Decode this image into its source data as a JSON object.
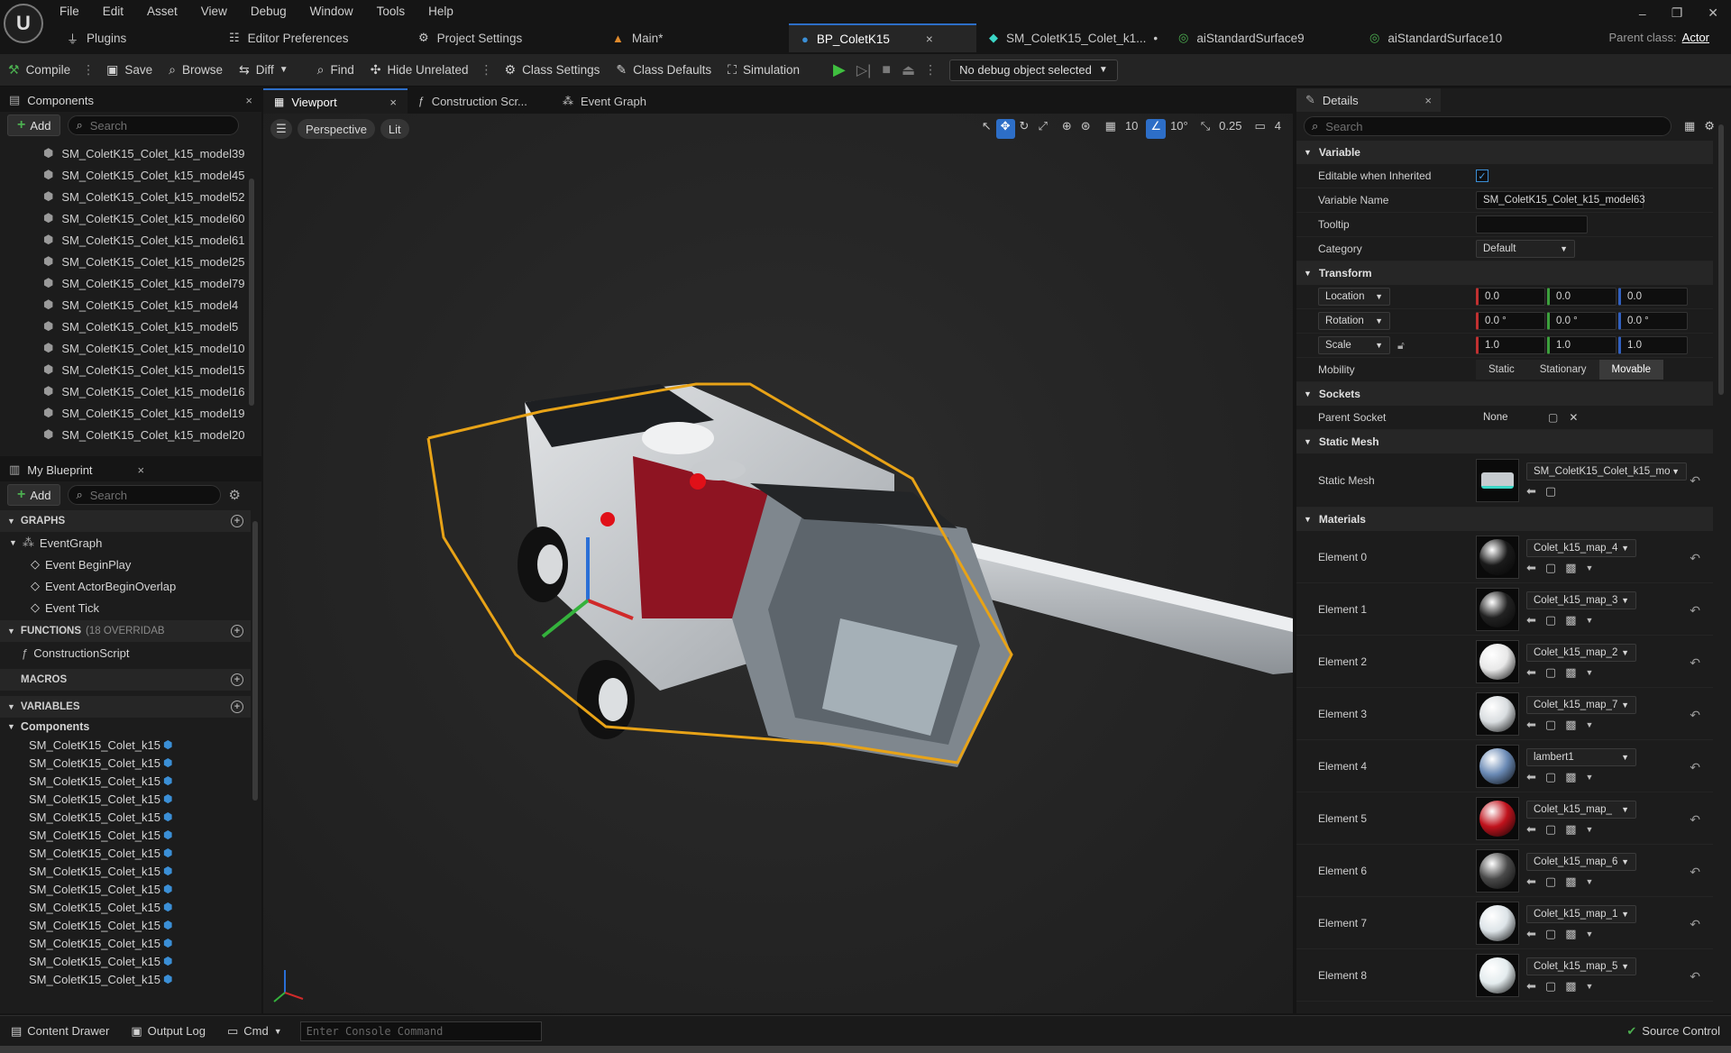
{
  "menus": [
    "File",
    "Edit",
    "Asset",
    "View",
    "Debug",
    "Window",
    "Tools",
    "Help"
  ],
  "tabs": [
    {
      "label": "Plugins",
      "icon": "plug-icon"
    },
    {
      "label": "Editor Preferences",
      "icon": "sliders-icon"
    },
    {
      "label": "Project Settings",
      "icon": "gear-icon"
    },
    {
      "label": "Main*",
      "icon": "level-icon"
    },
    {
      "label": "BP_ColetK15",
      "icon": "blueprint-icon",
      "close": "×"
    },
    {
      "label": "SM_ColetK15_Colet_k1...",
      "icon": "static-mesh-icon",
      "mark": "•"
    },
    {
      "label": "aiStandardSurface9",
      "icon": "material-icon"
    },
    {
      "label": "aiStandardSurface10",
      "icon": "material-icon"
    }
  ],
  "parent_class": {
    "label": "Parent class:",
    "value": "Actor"
  },
  "toolbar": {
    "compile": "Compile",
    "save": "Save",
    "browse": "Browse",
    "diff": "Diff",
    "find": "Find",
    "hide_unrelated": "Hide Unrelated",
    "class_settings": "Class Settings",
    "class_defaults": "Class Defaults",
    "simulation": "Simulation",
    "debug_select": "No debug object selected"
  },
  "components": {
    "title": "Components",
    "add": "Add",
    "search_placeholder": "Search",
    "items": [
      "SM_ColetK15_Colet_k15_model39",
      "SM_ColetK15_Colet_k15_model45",
      "SM_ColetK15_Colet_k15_model52",
      "SM_ColetK15_Colet_k15_model60",
      "SM_ColetK15_Colet_k15_model61",
      "SM_ColetK15_Colet_k15_model25",
      "SM_ColetK15_Colet_k15_model79",
      "SM_ColetK15_Colet_k15_model4",
      "SM_ColetK15_Colet_k15_model5",
      "SM_ColetK15_Colet_k15_model10",
      "SM_ColetK15_Colet_k15_model15",
      "SM_ColetK15_Colet_k15_model16",
      "SM_ColetK15_Colet_k15_model19",
      "SM_ColetK15_Colet_k15_model20"
    ]
  },
  "my_blueprint": {
    "title": "My Blueprint",
    "add": "Add",
    "search_placeholder": "Search",
    "graphs_label": "GRAPHS",
    "event_graph": "EventGraph",
    "events": [
      "Event BeginPlay",
      "Event ActorBeginOverlap",
      "Event Tick"
    ],
    "functions_label": "FUNCTIONS",
    "functions_sub": "(18 OVERRIDAB",
    "construction_script": "ConstructionScript",
    "macros_label": "MACROS",
    "variables_label": "VARIABLES",
    "components_label": "Components",
    "variables": [
      "SM_ColetK15_Colet_k15",
      "SM_ColetK15_Colet_k15",
      "SM_ColetK15_Colet_k15",
      "SM_ColetK15_Colet_k15",
      "SM_ColetK15_Colet_k15",
      "SM_ColetK15_Colet_k15",
      "SM_ColetK15_Colet_k15",
      "SM_ColetK15_Colet_k15",
      "SM_ColetK15_Colet_k15",
      "SM_ColetK15_Colet_k15",
      "SM_ColetK15_Colet_k15",
      "SM_ColetK15_Colet_k15",
      "SM_ColetK15_Colet_k15",
      "SM_ColetK15_Colet_k15"
    ]
  },
  "viewport_tabs": [
    "Viewport",
    "Construction Scr...",
    "Event Graph"
  ],
  "viewport": {
    "perspective": "Perspective",
    "lit": "Lit",
    "grid_size": "10",
    "rot_snap": "10°",
    "scale_snap": "0.25",
    "cam_speed": "4"
  },
  "details": {
    "title": "Details",
    "search_placeholder": "Search",
    "variable_section": "Variable",
    "editable_label": "Editable when Inherited",
    "editable_check": "✓",
    "var_name_label": "Variable Name",
    "var_name": "SM_ColetK15_Colet_k15_model63",
    "tooltip_label": "Tooltip",
    "category_label": "Category",
    "category": "Default",
    "transform_section": "Transform",
    "location_label": "Location",
    "location": [
      "0.0",
      "0.0",
      "0.0"
    ],
    "rotation_label": "Rotation",
    "rotation": [
      "0.0 °",
      "0.0 °",
      "0.0 °"
    ],
    "scale_label": "Scale",
    "scale": [
      "1.0",
      "1.0",
      "1.0"
    ],
    "mobility_label": "Mobility",
    "mobility_options": [
      "Static",
      "Stationary",
      "Movable"
    ],
    "mobility_selected": "Movable",
    "sockets_section": "Sockets",
    "parent_socket_label": "Parent Socket",
    "parent_socket": "None",
    "static_mesh_section": "Static Mesh",
    "static_mesh_label": "Static Mesh",
    "static_mesh": "SM_ColetK15_Colet_k15_mo",
    "materials_section": "Materials",
    "materials": [
      {
        "label": "Element 0",
        "value": "Colet_k15_map_4",
        "color": "#1a1a1a"
      },
      {
        "label": "Element 1",
        "value": "Colet_k15_map_3",
        "color": "#222222"
      },
      {
        "label": "Element 2",
        "value": "Colet_k15_map_2",
        "color": "#e8e8e8"
      },
      {
        "label": "Element 3",
        "value": "Colet_k15_map_7",
        "color": "#d9dde0"
      },
      {
        "label": "Element 4",
        "value": "lambert1",
        "color": "#6a8ab5"
      },
      {
        "label": "Element 5",
        "value": "Colet_k15_map_",
        "color": "#c0121c"
      },
      {
        "label": "Element 6",
        "value": "Colet_k15_map_6",
        "color": "#4a4a4a"
      },
      {
        "label": "Element 7",
        "value": "Colet_k15_map_1",
        "color": "#dde4e8"
      },
      {
        "label": "Element 8",
        "value": "Colet_k15_map_5",
        "color": "#e4ecee"
      }
    ]
  },
  "statusbar": {
    "content_drawer": "Content Drawer",
    "output_log": "Output Log",
    "cmd": "Cmd",
    "console_placeholder": "Enter Console Command",
    "source_control": "Source Control"
  },
  "colors": {
    "accent": "#2d6ec7",
    "selection_outline": "#e8a317",
    "play": "#3fbf3f"
  }
}
